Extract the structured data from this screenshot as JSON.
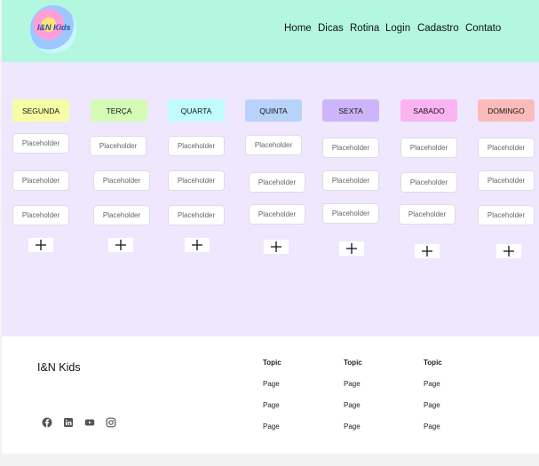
{
  "header": {
    "logo_text": "I&N Kids",
    "nav": [
      "Home",
      "Dicas",
      "Rotina",
      "Login",
      "Cadastro",
      "Contato"
    ]
  },
  "days": [
    {
      "label": "SEGUNDA",
      "color": "#f7fda4"
    },
    {
      "label": "TERÇA",
      "color": "#d5fcb6"
    },
    {
      "label": "QUARTA",
      "color": "#bffcfb"
    },
    {
      "label": "QUINTA",
      "color": "#b8d3fb"
    },
    {
      "label": "SEXTA",
      "color": "#cdb5fb"
    },
    {
      "label": "SABADO",
      "color": "#fcb3f2"
    },
    {
      "label": "DOMINGO",
      "color": "#fcbbbb"
    }
  ],
  "placeholder": "Placeholder",
  "footer": {
    "brand": "I&N Kids",
    "social_icons": [
      "facebook-icon",
      "linkedin-icon",
      "youtube-icon",
      "instagram-icon"
    ],
    "columns": [
      {
        "topic": "Topic",
        "pages": [
          "Page",
          "Page",
          "Page"
        ]
      },
      {
        "topic": "Topic",
        "pages": [
          "Page",
          "Page",
          "Page"
        ]
      },
      {
        "topic": "Topic",
        "pages": [
          "Page",
          "Page",
          "Page"
        ]
      }
    ]
  }
}
